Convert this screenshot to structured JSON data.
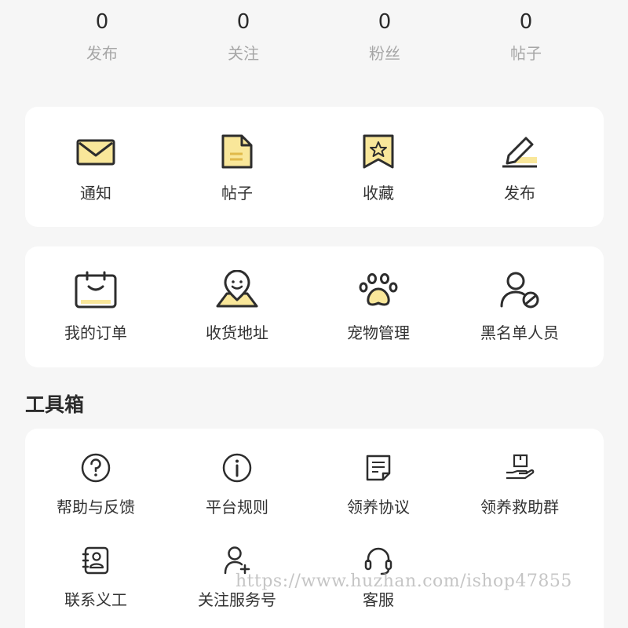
{
  "stats": [
    {
      "value": "0",
      "label": "发布"
    },
    {
      "value": "0",
      "label": "关注"
    },
    {
      "value": "0",
      "label": "粉丝"
    },
    {
      "value": "0",
      "label": "帖子"
    }
  ],
  "quick": [
    {
      "label": "通知",
      "icon": "envelope-icon"
    },
    {
      "label": "帖子",
      "icon": "document-icon"
    },
    {
      "label": "收藏",
      "icon": "bookmark-star-icon"
    },
    {
      "label": "发布",
      "icon": "pencil-icon"
    }
  ],
  "services": [
    {
      "label": "我的订单",
      "icon": "order-icon"
    },
    {
      "label": "收货地址",
      "icon": "address-pin-icon"
    },
    {
      "label": "宠物管理",
      "icon": "paw-icon"
    },
    {
      "label": "黑名单人员",
      "icon": "blocked-user-icon"
    }
  ],
  "toolbox": {
    "title": "工具箱",
    "row1": [
      {
        "label": "帮助与反馈",
        "icon": "help-icon"
      },
      {
        "label": "平台规则",
        "icon": "info-icon"
      },
      {
        "label": "领养协议",
        "icon": "agreement-icon"
      },
      {
        "label": "领养救助群",
        "icon": "hand-box-icon"
      }
    ],
    "row2": [
      {
        "label": "联系义工",
        "icon": "contact-card-icon"
      },
      {
        "label": "关注服务号",
        "icon": "add-user-icon"
      },
      {
        "label": "客服",
        "icon": "headset-icon"
      }
    ]
  },
  "watermark": "https://www.huzhan.com/ishop47855",
  "colors": {
    "accent": "#f9e79a",
    "stroke": "#2d2d2d",
    "background": "#f6f6f6"
  }
}
